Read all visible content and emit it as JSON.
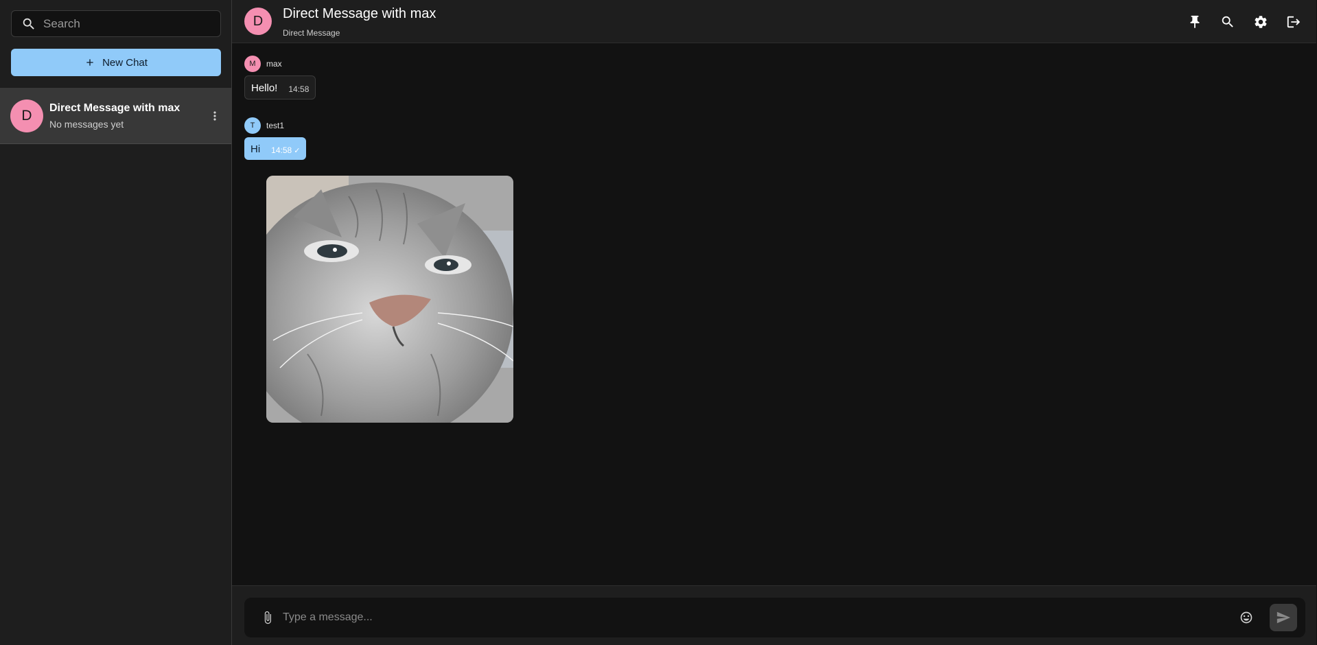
{
  "sidebar": {
    "search_placeholder": "Search",
    "new_chat_label": "New Chat",
    "chats": [
      {
        "avatar_letter": "D",
        "title": "Direct Message with max",
        "subtitle": "No messages yet"
      }
    ]
  },
  "header": {
    "avatar_letter": "D",
    "title": "Direct Message with max",
    "subtitle": "Direct Message"
  },
  "messages": [
    {
      "sender": "max",
      "avatar_letter": "M",
      "avatar_color": "#f48fb1",
      "text": "Hello!",
      "time": "14:58"
    },
    {
      "sender": "test1",
      "avatar_letter": "T",
      "avatar_color": "#90caf9",
      "text": "Hi",
      "time": "14:58",
      "status": "✓"
    }
  ],
  "composer": {
    "placeholder": "Type a message..."
  },
  "colors": {
    "accent": "#90caf9",
    "avatar_pink": "#f48fb1",
    "background": "#121212",
    "panel": "#1e1e1e"
  },
  "icons": [
    "search-icon",
    "plus-icon",
    "more-vert-icon",
    "pin-icon",
    "search-icon",
    "settings-icon",
    "logout-icon",
    "attach-icon",
    "emoji-icon",
    "send-icon"
  ]
}
